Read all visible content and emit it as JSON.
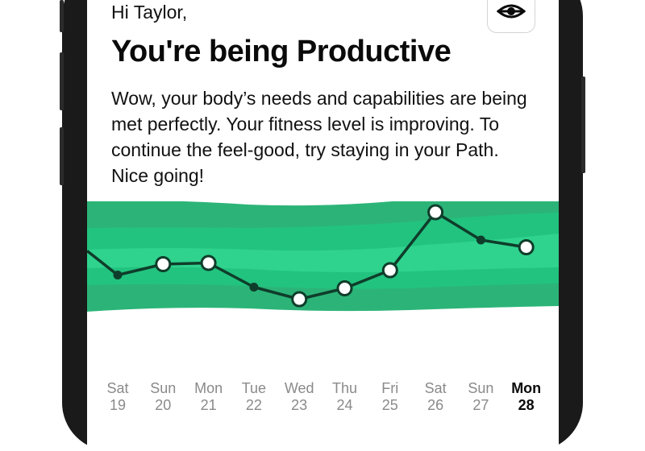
{
  "greeting": "Hi Taylor,",
  "headline": "You're being Productive",
  "body": "Wow, your body’s needs and capabilities are being met perfectly. Your fitness level is improving. To continue the feel-good, try staying in your Path. Nice going!",
  "header": {
    "view_icon": "eye-icon"
  },
  "colors": {
    "band_outer": "#2cb478",
    "band_middle": "#22c37f",
    "band_inner": "#2fd38e",
    "line": "#0f3d2b"
  },
  "days": [
    {
      "name": "Sat",
      "num": "19"
    },
    {
      "name": "Sun",
      "num": "20"
    },
    {
      "name": "Mon",
      "num": "21"
    },
    {
      "name": "Tue",
      "num": "22"
    },
    {
      "name": "Wed",
      "num": "23"
    },
    {
      "name": "Thu",
      "num": "24"
    },
    {
      "name": "Fri",
      "num": "25"
    },
    {
      "name": "Sat",
      "num": "26"
    },
    {
      "name": "Sun",
      "num": "27"
    },
    {
      "name": "Mon",
      "num": "28"
    }
  ],
  "today_index": 9,
  "chart_data": {
    "type": "line",
    "categories": [
      "Sat",
      "Sun",
      "Mon",
      "Tue",
      "Wed",
      "Thu",
      "Fri",
      "Sat",
      "Sun",
      "Mon"
    ],
    "series": [
      {
        "values": [
          39,
          48,
          49,
          29,
          19,
          28,
          43,
          91,
          68,
          62
        ]
      }
    ],
    "marker_style": [
      "filled",
      "open",
      "open",
      "filled",
      "open",
      "open",
      "open",
      "open",
      "filled",
      "open"
    ],
    "ylim": [
      0,
      100
    ]
  }
}
